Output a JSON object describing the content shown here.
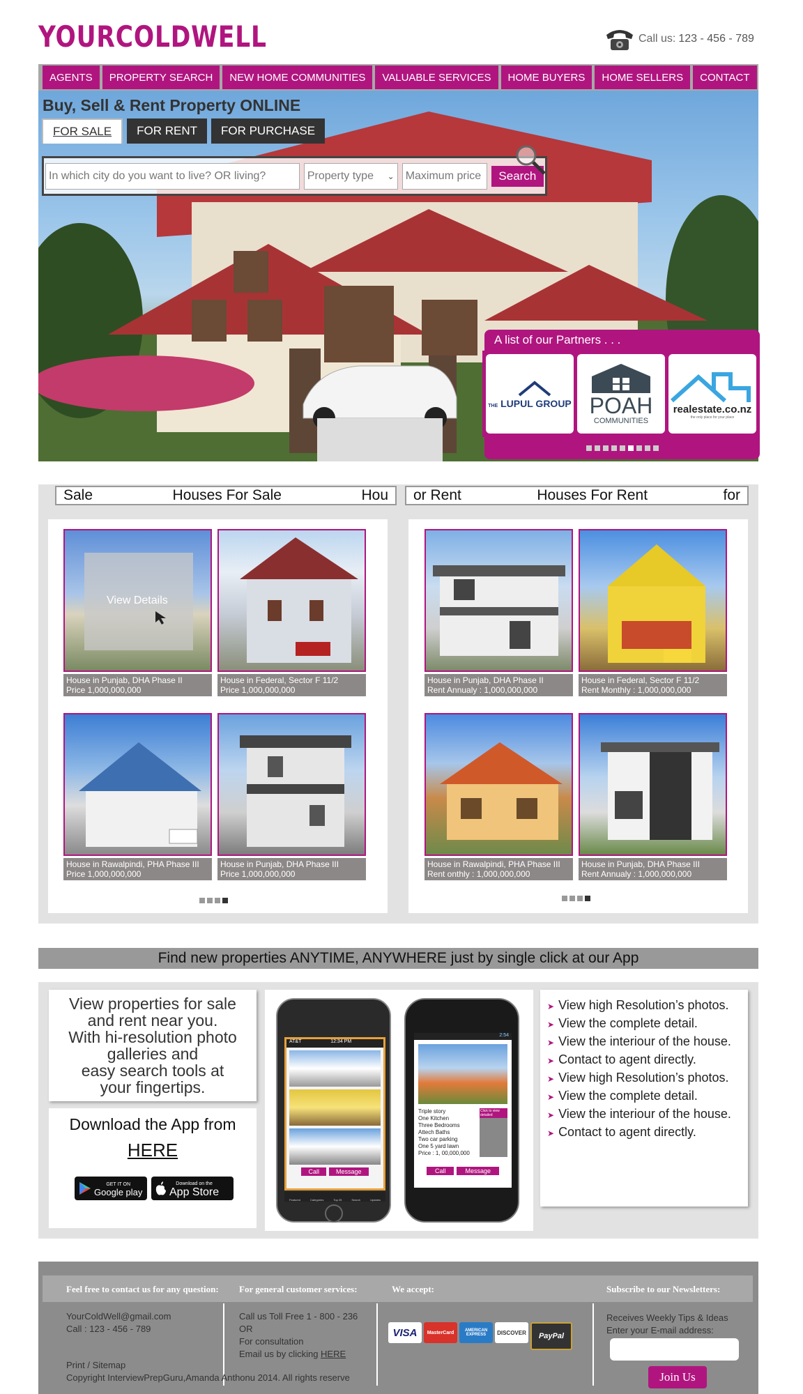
{
  "header": {
    "logo": "YOURCOLDWELL",
    "call_label": "Call us:",
    "phone": "123 - 456 - 789"
  },
  "nav": [
    "AGENTS",
    "PROPERTY SEARCH",
    "NEW HOME COMMUNITIES",
    "VALUABLE SERVICES",
    "HOME BUYERS",
    "HOME SELLERS",
    "CONTACT"
  ],
  "hero": {
    "title": "Buy, Sell & Rent Property ONLINE",
    "tabs": [
      "FOR SALE",
      "FOR RENT",
      "FOR PURCHASE"
    ],
    "city_placeholder": "In which city do you want to live? OR living?",
    "property_type": "Property type",
    "max_price_placeholder": "Maximum price",
    "search_label": "Search"
  },
  "partners": {
    "title": "A list of our Partners . . .",
    "items": [
      {
        "name": "LUPUL GROUP",
        "prefix": "THE"
      },
      {
        "name": "POAH",
        "sub": "COMMUNITIES"
      },
      {
        "name": "realestate.co.nz",
        "sub": "the only place for your place"
      }
    ],
    "active_dot": 5,
    "dot_count": 9
  },
  "sale": {
    "header_left": "Sale",
    "header_center": "Houses For Sale",
    "header_right": "Hou",
    "view_details": "View Details",
    "cards": [
      {
        "line1": "House in Punjab, DHA Phase II",
        "line2": "Price 1,000,000,000"
      },
      {
        "line1": "House in Federal, Sector F 11/2",
        "line2": "Price 1,000,000,000"
      },
      {
        "line1": "House in Rawalpindi, PHA Phase III",
        "line2": "Price 1,000,000,000"
      },
      {
        "line1": "House in Punjab, DHA Phase III",
        "line2": "Price 1,000,000,000"
      }
    ]
  },
  "rent": {
    "header_left": "or Rent",
    "header_center": "Houses For Rent",
    "header_right": "for",
    "cards": [
      {
        "line1": "House in Punjab, DHA Phase II",
        "line2": "Rent Annualy : 1,000,000,000"
      },
      {
        "line1": "House in Federal, Sector F 11/2",
        "line2": "Rent Monthly : 1,000,000,000"
      },
      {
        "line1": "House in Rawalpindi, PHA Phase III",
        "line2": "Rent onthly : 1,000,000,000"
      },
      {
        "line1": "House in Punjab, DHA Phase III",
        "line2": "Rent Annualy : 1,000,000,000"
      }
    ]
  },
  "app": {
    "banner": "Find new properties ANYTIME, ANYWHERE just by single click at our App",
    "intro_lines": [
      "View properties for sale",
      "and rent near you.",
      "With hi-resolution photo",
      "galleries and",
      "easy search tools at",
      "your fingertips."
    ],
    "download_label": "Download the App from",
    "here": "HERE",
    "google_small": "GET IT ON",
    "google_big": "Google play",
    "apple_small": "Download on the",
    "apple_big": "App Store",
    "phone1": {
      "carrier": "AT&T",
      "time": "12:34 PM",
      "call": "Call",
      "message": "Message",
      "tabs": [
        "Featured",
        "Categories",
        "Top 25",
        "Search",
        "Updates"
      ]
    },
    "phone2": {
      "time": "2:54",
      "call": "Call",
      "message": "Message",
      "badge": "Click to view detailed",
      "details": [
        "Triple story",
        "One Kitchen",
        "Three Bedrooms",
        "Attech Baths",
        "Two car parking",
        "One 5 yard lawn",
        "Price : 1, 00,000,000"
      ]
    },
    "features": [
      "View high Resolution’s photos.",
      "View the complete detail.",
      "View the interiour of the house.",
      "Contact to agent directly.",
      "View high Resolution’s photos.",
      "View the complete detail.",
      "View the interiour of the house.",
      "Contact to agent directly."
    ]
  },
  "footer": {
    "contact_head": "Feel free to contact us for any question:",
    "email": "YourColdWell@gmail.com",
    "call": "Call : 123 - 456 - 789",
    "print_sitemap": "Print / Sitemap",
    "copyright": "Copyright InterviewPrepGuru,Amanda Anthonu 2014.  All rights reserve",
    "service_head": "For general customer services:",
    "service_lines": [
      "Call us Toll Free 1 - 800 - 236",
      "OR",
      "For consultation"
    ],
    "service_email_text": "Email us by clicking ",
    "service_here": "HERE",
    "accept_head": "We accept:",
    "cards": [
      "VISA",
      "MasterCard",
      "AMERICAN EXPRESS",
      "DISCOVER",
      "PayPal"
    ],
    "newsletter_head": "Subscribe to our Newsletters:",
    "newsletter_lines": [
      "Receives Weekly Tips & Ideas",
      "Enter your E-mail address:"
    ],
    "join": "Join Us"
  }
}
